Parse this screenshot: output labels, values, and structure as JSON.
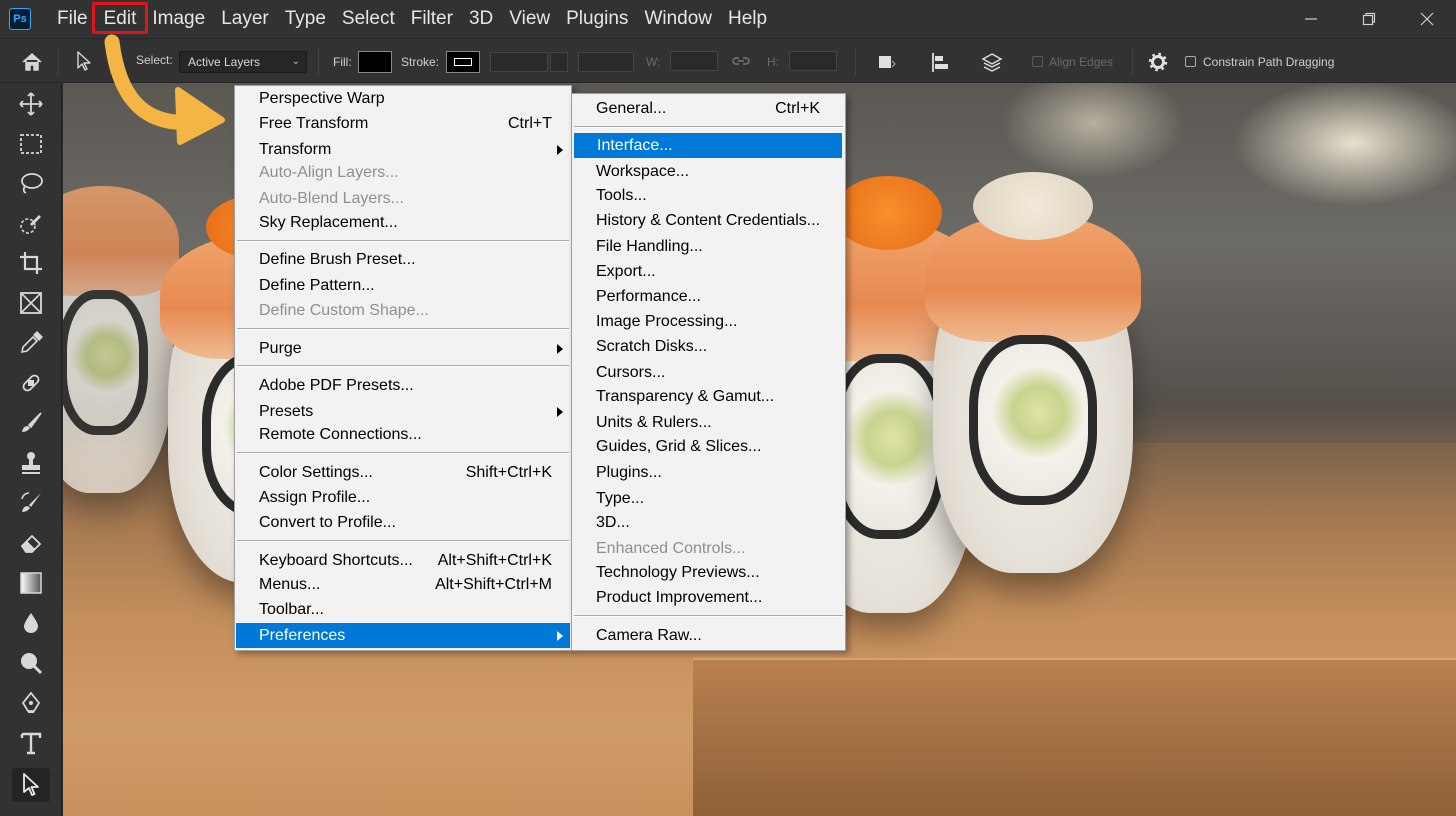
{
  "app": {
    "logo_text": "Ps"
  },
  "menubar": {
    "items": [
      "File",
      "Edit",
      "Image",
      "Layer",
      "Type",
      "Select",
      "Filter",
      "3D",
      "View",
      "Plugins",
      "Window",
      "Help"
    ],
    "highlighted": "Edit"
  },
  "options_bar": {
    "select_label": "Select:",
    "select_value": "Active Layers",
    "fill_label": "Fill:",
    "fill_color": "#000000",
    "stroke_label": "Stroke:",
    "w_label": "W:",
    "h_label": "H:",
    "align_edges_label": "Align Edges",
    "constrain_label": "Constrain Path Dragging"
  },
  "toolbar": {
    "tools": [
      "move-tool",
      "marquee-tool",
      "lasso-tool",
      "quick-selection-tool",
      "crop-tool",
      "frame-tool",
      "eyedropper-tool",
      "spot-healing-tool",
      "brush-tool",
      "clone-stamp-tool",
      "history-brush-tool",
      "eraser-tool",
      "gradient-tool",
      "blur-tool",
      "dodge-tool",
      "pen-tool",
      "type-tool",
      "path-selection-tool"
    ],
    "active": "path-selection-tool"
  },
  "edit_menu": {
    "items": [
      {
        "label": "Perspective Warp",
        "shortcut": "",
        "disabled": false,
        "submenu": false
      },
      {
        "label": "Free Transform",
        "shortcut": "Ctrl+T",
        "disabled": false,
        "submenu": false
      },
      {
        "label": "Transform",
        "shortcut": "",
        "disabled": false,
        "submenu": true
      },
      {
        "label": "Auto-Align Layers...",
        "shortcut": "",
        "disabled": true,
        "submenu": false
      },
      {
        "label": "Auto-Blend Layers...",
        "shortcut": "",
        "disabled": true,
        "submenu": false
      },
      {
        "label": "Sky Replacement...",
        "shortcut": "",
        "disabled": false,
        "submenu": false
      },
      {
        "label": "Define Brush Preset...",
        "shortcut": "",
        "disabled": false,
        "submenu": false
      },
      {
        "label": "Define Pattern...",
        "shortcut": "",
        "disabled": false,
        "submenu": false
      },
      {
        "label": "Define Custom Shape...",
        "shortcut": "",
        "disabled": true,
        "submenu": false
      },
      {
        "label": "Purge",
        "shortcut": "",
        "disabled": false,
        "submenu": true
      },
      {
        "label": "Adobe PDF Presets...",
        "shortcut": "",
        "disabled": false,
        "submenu": false
      },
      {
        "label": "Presets",
        "shortcut": "",
        "disabled": false,
        "submenu": true
      },
      {
        "label": "Remote Connections...",
        "shortcut": "",
        "disabled": false,
        "submenu": false
      },
      {
        "label": "Color Settings...",
        "shortcut": "Shift+Ctrl+K",
        "disabled": false,
        "submenu": false
      },
      {
        "label": "Assign Profile...",
        "shortcut": "",
        "disabled": false,
        "submenu": false
      },
      {
        "label": "Convert to Profile...",
        "shortcut": "",
        "disabled": false,
        "submenu": false
      },
      {
        "label": "Keyboard Shortcuts...",
        "shortcut": "Alt+Shift+Ctrl+K",
        "disabled": false,
        "submenu": false
      },
      {
        "label": "Menus...",
        "shortcut": "Alt+Shift+Ctrl+M",
        "disabled": false,
        "submenu": false
      },
      {
        "label": "Toolbar...",
        "shortcut": "",
        "disabled": false,
        "submenu": false
      },
      {
        "label": "Preferences",
        "shortcut": "",
        "disabled": false,
        "submenu": true,
        "selected": true
      }
    ]
  },
  "preferences_menu": {
    "items": [
      {
        "label": "General...",
        "shortcut": "Ctrl+K",
        "disabled": false
      },
      {
        "label": "Interface...",
        "shortcut": "",
        "disabled": false,
        "selected": true
      },
      {
        "label": "Workspace...",
        "shortcut": "",
        "disabled": false
      },
      {
        "label": "Tools...",
        "shortcut": "",
        "disabled": false
      },
      {
        "label": "History & Content Credentials...",
        "shortcut": "",
        "disabled": false
      },
      {
        "label": "File Handling...",
        "shortcut": "",
        "disabled": false
      },
      {
        "label": "Export...",
        "shortcut": "",
        "disabled": false
      },
      {
        "label": "Performance...",
        "shortcut": "",
        "disabled": false
      },
      {
        "label": "Image Processing...",
        "shortcut": "",
        "disabled": false
      },
      {
        "label": "Scratch Disks...",
        "shortcut": "",
        "disabled": false
      },
      {
        "label": "Cursors...",
        "shortcut": "",
        "disabled": false
      },
      {
        "label": "Transparency & Gamut...",
        "shortcut": "",
        "disabled": false
      },
      {
        "label": "Units & Rulers...",
        "shortcut": "",
        "disabled": false
      },
      {
        "label": "Guides, Grid & Slices...",
        "shortcut": "",
        "disabled": false
      },
      {
        "label": "Plugins...",
        "shortcut": "",
        "disabled": false
      },
      {
        "label": "Type...",
        "shortcut": "",
        "disabled": false
      },
      {
        "label": "3D...",
        "shortcut": "",
        "disabled": false
      },
      {
        "label": "Enhanced Controls...",
        "shortcut": "",
        "disabled": true
      },
      {
        "label": "Technology Previews...",
        "shortcut": "",
        "disabled": false
      },
      {
        "label": "Product Improvement...",
        "shortcut": "",
        "disabled": false
      },
      {
        "label": "Camera Raw...",
        "shortcut": "",
        "disabled": false
      }
    ]
  },
  "colors": {
    "highlight_blue": "#0078d7",
    "callout_red": "#e0151a",
    "arrow_yellow": "#f5b544",
    "chrome_dark": "#323232"
  }
}
